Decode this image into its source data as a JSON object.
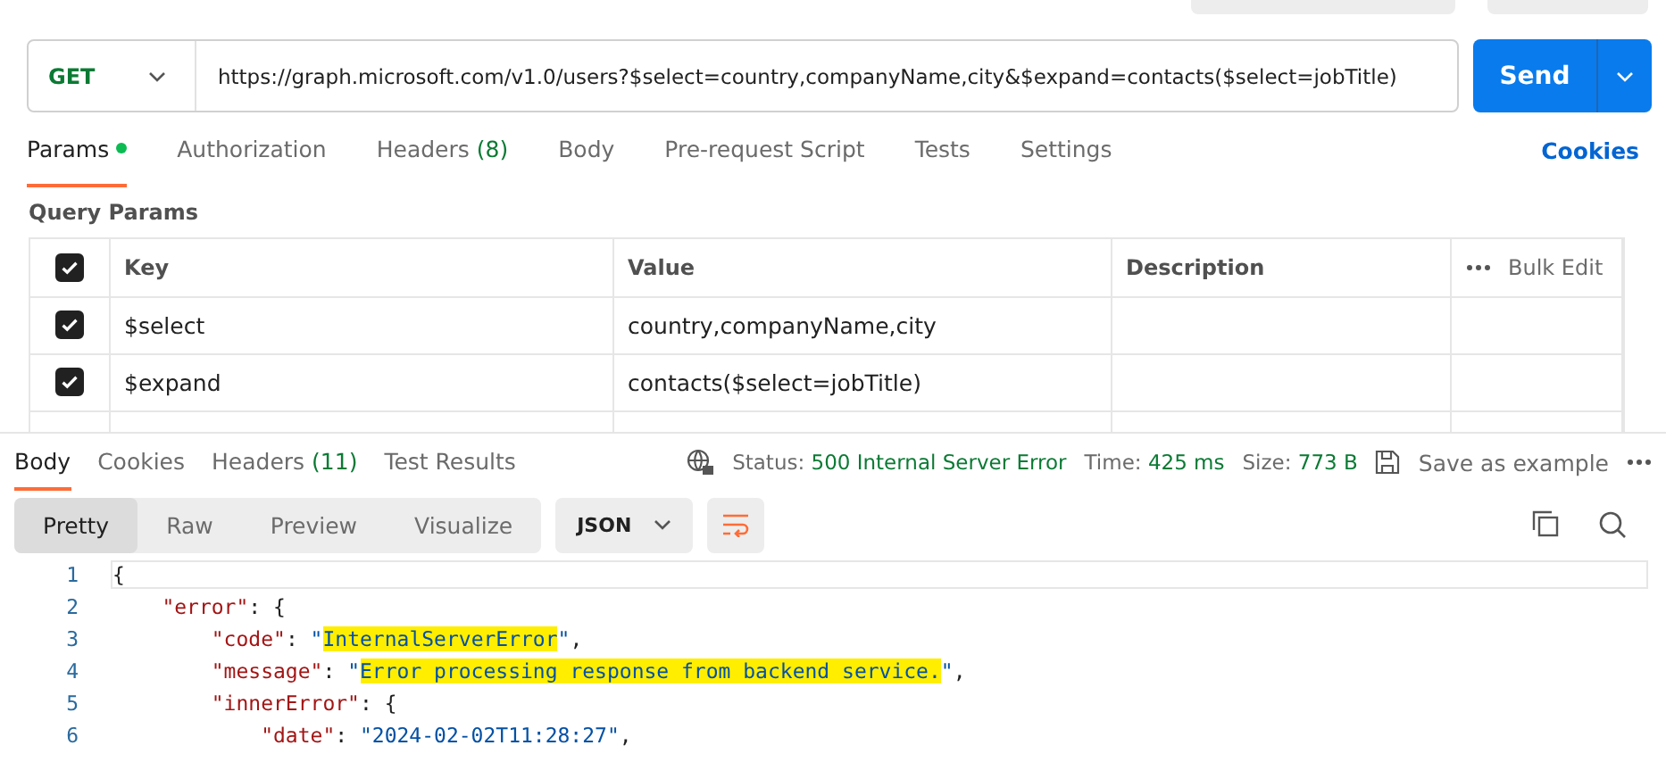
{
  "request": {
    "method": "GET",
    "url": "https://graph.microsoft.com/v1.0/users?$select=country,companyName,city&$expand=contacts($select=jobTitle)",
    "send_label": "Send"
  },
  "request_tabs": [
    {
      "label": "Params",
      "dot": true,
      "selected": true
    },
    {
      "label": "Authorization",
      "dot": false,
      "selected": false
    },
    {
      "label": "Headers",
      "count": "(8)",
      "dot": false,
      "selected": false
    },
    {
      "label": "Body",
      "dot": false,
      "selected": false
    },
    {
      "label": "Pre-request Script",
      "dot": false,
      "selected": false
    },
    {
      "label": "Tests",
      "dot": false,
      "selected": false
    },
    {
      "label": "Settings",
      "dot": false,
      "selected": false
    }
  ],
  "cookies_link": "Cookies",
  "query_params": {
    "title": "Query Params",
    "columns": [
      "Key",
      "Value",
      "Description"
    ],
    "header_checked": true,
    "bulk_edit": "Bulk Edit",
    "rows": [
      {
        "checked": true,
        "key": "$select",
        "value": "country,companyName,city"
      },
      {
        "checked": true,
        "key": "$expand",
        "value": "contacts($select=jobTitle)"
      }
    ]
  },
  "response_tabs": [
    {
      "label": "Body",
      "selected": true
    },
    {
      "label": "Cookies",
      "selected": false
    },
    {
      "label": "Headers",
      "count": "(11)",
      "selected": false
    },
    {
      "label": "Test Results",
      "selected": false
    }
  ],
  "status": {
    "status_label": "Status:",
    "status_value": "500 Internal Server Error",
    "time_label": "Time:",
    "time_value": "425 ms",
    "size_label": "Size:",
    "size_value": "773 B",
    "save_label": "Save as example"
  },
  "view_modes": [
    {
      "label": "Pretty",
      "selected": true
    },
    {
      "label": "Raw",
      "selected": false
    },
    {
      "label": "Preview",
      "selected": false
    },
    {
      "label": "Visualize",
      "selected": false
    }
  ],
  "format": "JSON",
  "code_lines": [
    {
      "number": "1",
      "tokens": [
        {
          "kind": "punct",
          "text": "{"
        }
      ]
    },
    {
      "number": "2",
      "tokens": [
        {
          "kind": "key",
          "text": "    \"error\""
        },
        {
          "kind": "punct",
          "text": ": {"
        }
      ]
    },
    {
      "number": "3",
      "tokens": [
        {
          "kind": "key",
          "text": "        \"code\""
        },
        {
          "kind": "punct",
          "text": ": "
        },
        {
          "kind": "string",
          "text": "\""
        },
        {
          "kind": "highlight",
          "text": "InternalServerError"
        },
        {
          "kind": "string",
          "text": "\""
        },
        {
          "kind": "punct",
          "text": ","
        }
      ]
    },
    {
      "number": "4",
      "tokens": [
        {
          "kind": "key",
          "text": "        \"message\""
        },
        {
          "kind": "punct",
          "text": ": "
        },
        {
          "kind": "string",
          "text": "\""
        },
        {
          "kind": "highlight",
          "text": "Error processing response from backend service."
        },
        {
          "kind": "string",
          "text": "\""
        },
        {
          "kind": "punct",
          "text": ","
        }
      ]
    },
    {
      "number": "5",
      "tokens": [
        {
          "kind": "key",
          "text": "        \"innerError\""
        },
        {
          "kind": "punct",
          "text": ": {"
        }
      ]
    },
    {
      "number": "6",
      "tokens": [
        {
          "kind": "key",
          "text": "            \"date\""
        },
        {
          "kind": "punct",
          "text": ": "
        },
        {
          "kind": "string",
          "text": "\"2024-02-02T11:28:27\""
        },
        {
          "kind": "punct",
          "text": ","
        }
      ]
    }
  ]
}
